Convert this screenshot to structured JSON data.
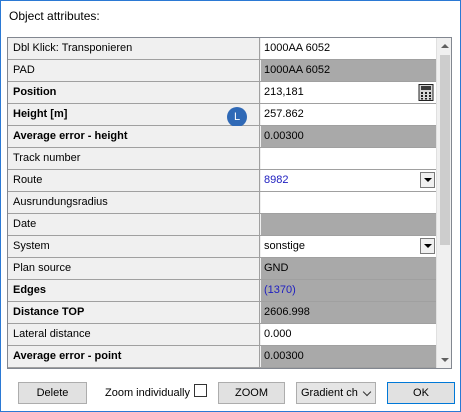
{
  "window": {
    "title": "Object attributes:"
  },
  "rows": [
    {
      "label": "Dbl Klick: Transponieren",
      "bold": false,
      "value": "1000AA 6052",
      "kind": "rw",
      "control": ""
    },
    {
      "label": "PAD",
      "bold": false,
      "value": "1000AA 6052",
      "kind": "ro",
      "control": ""
    },
    {
      "label": "Position",
      "bold": true,
      "value": "213,181",
      "kind": "rw",
      "control": "calculator"
    },
    {
      "label": "Height [m]",
      "bold": true,
      "value": "257.862",
      "kind": "rw",
      "control": ""
    },
    {
      "label": "Average error - height",
      "bold": true,
      "value": "0.00300",
      "kind": "ro",
      "control": ""
    },
    {
      "label": "Track number",
      "bold": false,
      "value": "",
      "kind": "rw",
      "control": ""
    },
    {
      "label": "Route",
      "bold": false,
      "value": "8982",
      "kind": "rw",
      "control": "combo",
      "link": true
    },
    {
      "label": "Ausrundungsradius",
      "bold": false,
      "value": "",
      "kind": "rw",
      "control": ""
    },
    {
      "label": "Date",
      "bold": false,
      "value": "",
      "kind": "ro",
      "control": ""
    },
    {
      "label": "System",
      "bold": false,
      "value": "sonstige",
      "kind": "rw",
      "control": "combo"
    },
    {
      "label": "Plan source",
      "bold": false,
      "value": "GND",
      "kind": "ro",
      "control": ""
    },
    {
      "label": "Edges",
      "bold": true,
      "value": "(1370)",
      "kind": "ro",
      "control": "",
      "link": true
    },
    {
      "label": "Distance TOP",
      "bold": true,
      "value": "2606.998",
      "kind": "ro",
      "control": ""
    },
    {
      "label": "Lateral distance",
      "bold": false,
      "value": "0.000",
      "kind": "rw",
      "control": ""
    },
    {
      "label": "Average error - point",
      "bold": true,
      "value": "0.00300",
      "kind": "ro",
      "control": ""
    }
  ],
  "badge": {
    "text": "L"
  },
  "footer": {
    "delete_label": "Delete",
    "zoom_individually_label": "Zoom individually",
    "zoom_individually_checked": false,
    "zoom_label": "ZOOM",
    "gradient_select_value": "Gradient ch",
    "ok_label": "OK"
  },
  "colors": {
    "readonly_bg": "#a9a9a9",
    "label_bg": "#f0f0f0",
    "link": "#2020c0",
    "badge": "#2f69b6",
    "window_border": "#2b79d4"
  },
  "icons": {
    "calculator": "calculator-icon",
    "combo": "chevron-down-icon"
  }
}
